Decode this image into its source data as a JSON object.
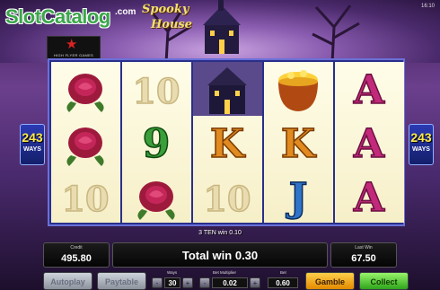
{
  "header": {
    "site_logo": "SlotCatalog",
    "site_logo_suffix": ".com",
    "studio_badge": "HIGH FLYER GAMES",
    "game_title_line1": "Spooky",
    "game_title_line2": "House",
    "clock_line1": "",
    "clock_line2": "16:10"
  },
  "ways_badge": {
    "number": "243",
    "word": "WAYS"
  },
  "reels": [
    [
      "rose",
      "rose",
      "10"
    ],
    [
      "10",
      "9",
      "rose"
    ],
    [
      "haunted-house",
      "K",
      "10"
    ],
    [
      "pot-of-gold",
      "K",
      "J"
    ],
    [
      "A",
      "A",
      "A"
    ]
  ],
  "win_line_text": "3 TEN win 0.10",
  "credit": {
    "label": "Credit",
    "value": "495.80"
  },
  "total_win": "Total win 0.30",
  "last_win": {
    "label": "Last Win",
    "value": "67.50"
  },
  "controls": {
    "autoplay": "Autoplay",
    "paytable": "Paytable",
    "ways_label": "Ways",
    "ways_value": "30",
    "multiplier_label": "Bet Multiplier",
    "multiplier_value": "0.02",
    "bet_label": "Bet",
    "bet_value": "0.60",
    "gamble": "Gamble",
    "collect": "Collect",
    "minus": "-",
    "plus": "+"
  },
  "colors": {
    "reel_frame": "#2a2f8a",
    "gamble_button": "#f0a020",
    "collect_button": "#4ccb2a",
    "letter_pink": "#c2297a",
    "letter_orange": "#e08a20"
  }
}
